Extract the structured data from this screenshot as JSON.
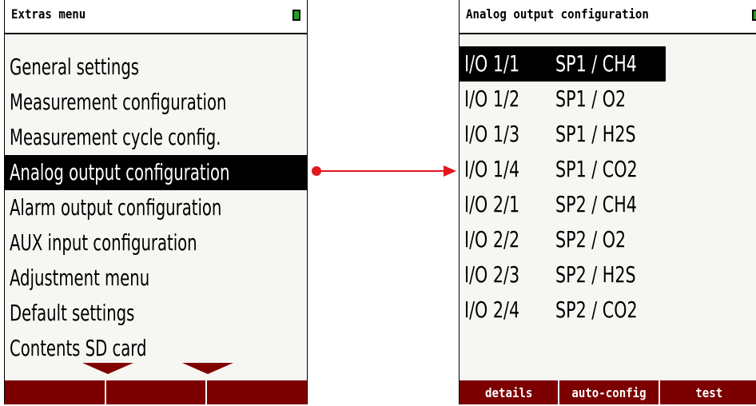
{
  "left_screen": {
    "title": "Extras menu",
    "battery_icon": "battery-icon",
    "menu_items": [
      {
        "label": "General settings"
      },
      {
        "label": "Measurement configuration"
      },
      {
        "label": "Measurement cycle config."
      },
      {
        "label": "Analog output configuration",
        "selected": true
      },
      {
        "label": "Alarm output configuration"
      },
      {
        "label": "AUX input configuration"
      },
      {
        "label": "Adjustment menu"
      },
      {
        "label": "Default settings"
      },
      {
        "label": "Contents SD card"
      }
    ],
    "softkeys": [
      "",
      "",
      ""
    ],
    "scroll_icons": [
      "chevron-down-icon",
      "chevron-down-icon"
    ]
  },
  "right_screen": {
    "title": "Analog output configuration",
    "battery_icon": "battery-icon",
    "rows": [
      {
        "port": "I/O 1/1",
        "signal": "SP1 / CH4",
        "selected": true
      },
      {
        "port": "I/O 1/2",
        "signal": "SP1 / O2"
      },
      {
        "port": "I/O 1/3",
        "signal": "SP1 / H2S"
      },
      {
        "port": "I/O 1/4",
        "signal": "SP1 / CO2"
      },
      {
        "port": "I/O 2/1",
        "signal": "SP2 / CH4"
      },
      {
        "port": "I/O 2/2",
        "signal": "SP2 / O2"
      },
      {
        "port": "I/O 2/3",
        "signal": "SP2 / H2S"
      },
      {
        "port": "I/O 2/4",
        "signal": "SP2 / CO2"
      }
    ],
    "softkeys": [
      "details",
      "auto-config",
      "test"
    ]
  },
  "colors": {
    "selection": "#000000",
    "softkey_bar": "#7d0000",
    "arrow": "#e3161c",
    "battery": "#1fa31f"
  }
}
